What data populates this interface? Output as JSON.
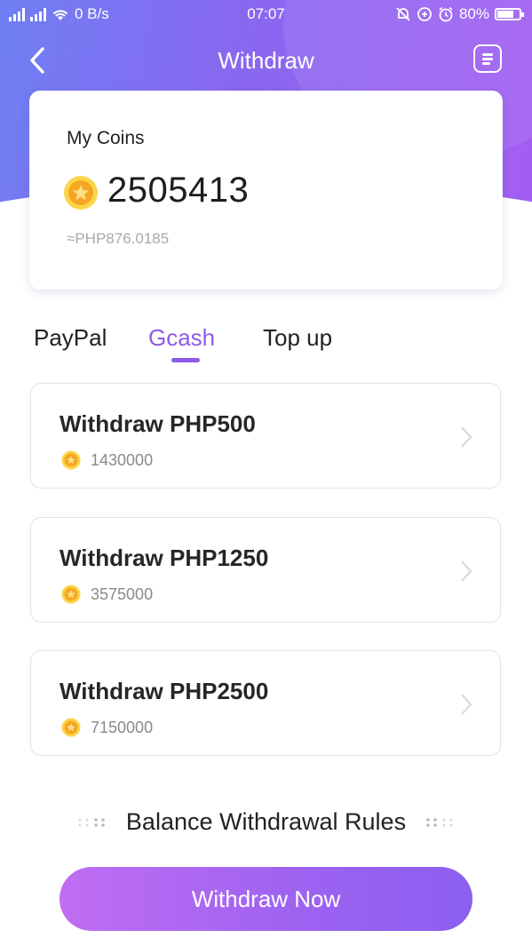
{
  "status_bar": {
    "network_speed": "0 B/s",
    "time": "07:07",
    "battery": "80%",
    "battery_level": 0.8
  },
  "nav": {
    "title": "Withdraw",
    "back_icon": "chevron-left-icon",
    "menu_icon": "document-list-icon"
  },
  "coins": {
    "label": "My Coins",
    "value": "2505413",
    "php_equivalent": "≈PHP876.0185"
  },
  "tabs": [
    {
      "label": "PayPal",
      "active": false
    },
    {
      "label": "Gcash",
      "active": true
    },
    {
      "label": "Top up",
      "active": false
    }
  ],
  "options": [
    {
      "title": "Withdraw PHP500",
      "cost": "1430000"
    },
    {
      "title": "Withdraw PHP1250",
      "cost": "3575000"
    },
    {
      "title": "Withdraw PHP2500",
      "cost": "7150000"
    }
  ],
  "rules_label": "Balance Withdrawal Rules",
  "primary_button": "Withdraw Now",
  "colors": {
    "accent": "#8e5be6",
    "header_start": "#6f7ff3",
    "header_end": "#a45ef1",
    "coin_gold": "#f5a623"
  }
}
